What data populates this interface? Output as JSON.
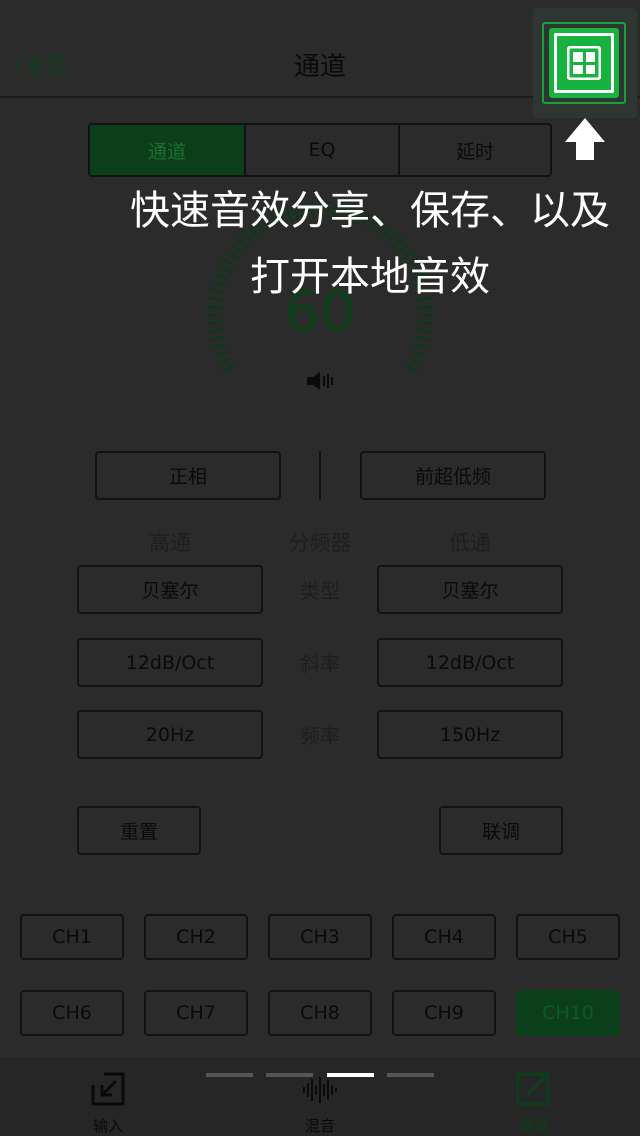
{
  "header": {
    "back_label": "主页",
    "title": "通道"
  },
  "tabs": [
    {
      "label": "通道",
      "active": true
    },
    {
      "label": "EQ"
    },
    {
      "label": "延时"
    }
  ],
  "volume": {
    "value": "60"
  },
  "phase_button": "正相",
  "subwoofer_button": "前超低频",
  "crossover": {
    "high_pass_header": "高通",
    "title": "分频器",
    "low_pass_header": "低通",
    "rows": [
      {
        "label": "类型",
        "high": "贝塞尔",
        "low": "贝塞尔"
      },
      {
        "label": "斜率",
        "high": "12dB/Oct",
        "low": "12dB/Oct"
      },
      {
        "label": "频率",
        "high": "20Hz",
        "low": "150Hz"
      }
    ]
  },
  "actions": {
    "reset": "重置",
    "link": "联调"
  },
  "channels": [
    "CH1",
    "CH2",
    "CH3",
    "CH4",
    "CH5",
    "CH6",
    "CH7",
    "CH8",
    "CH9",
    "CH10"
  ],
  "selected_channel": "CH10",
  "bottom_nav": [
    {
      "label": "输入"
    },
    {
      "label": "混音"
    },
    {
      "label": "通道",
      "active": true
    }
  ],
  "overlay": {
    "line1": "快速音效分享、保存、以及",
    "line2": "打开本地音效"
  },
  "page_indicator": {
    "count": 4,
    "active": 3
  },
  "colors": {
    "background": "#2b2b2b",
    "accent_green": "#0a3f19",
    "highlight_green": "#1fd04d",
    "overlay_text": "#ffffff"
  }
}
